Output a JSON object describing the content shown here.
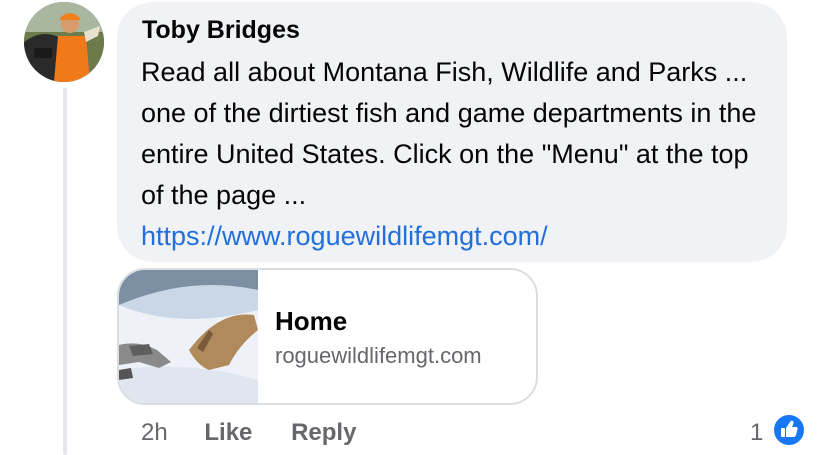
{
  "comment": {
    "author": "Toby Bridges",
    "text": "Read all about Montana Fish, Wildlife and Parks ... one of the dirtiest fish and game departments in the entire United States. Click on the \"Menu\" at the top of the page ...",
    "link": "https://www.roguewildlifemgt.com/"
  },
  "preview": {
    "title": "Home",
    "domain": "roguewildlifemgt.com"
  },
  "actions": {
    "time": "2h",
    "like_label": "Like",
    "reply_label": "Reply",
    "reaction_count": "1"
  },
  "icons": {
    "reaction": "like-thumbs-up-icon"
  },
  "colors": {
    "link": "#216fdb",
    "bubble": "#f0f2f5",
    "secondary_text": "#65676b",
    "like_blue": "#1877f2"
  }
}
